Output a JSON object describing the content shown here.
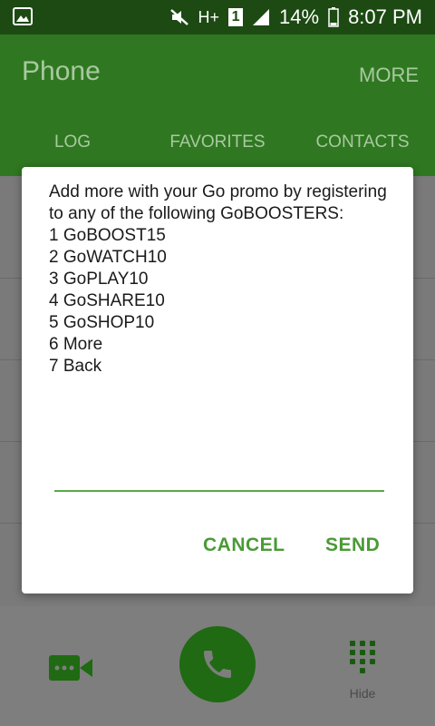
{
  "status_bar": {
    "battery": "14%",
    "time": "8:07 PM",
    "network": "H+",
    "sim": "1"
  },
  "app": {
    "title": "Phone",
    "more_label": "MORE"
  },
  "tabs": [
    {
      "label": "LOG"
    },
    {
      "label": "FAVORITES"
    },
    {
      "label": "CONTACTS"
    }
  ],
  "dialog": {
    "message": "Add more with your Go promo by registering to any of the following GoBOOSTERS:\n1 GoBOOST15\n2 GoWATCH10\n3 GoPLAY10\n4 GoSHARE10\n5 GoSHOP10\n6 More\n7 Back",
    "input_value": "",
    "cancel_label": "CANCEL",
    "send_label": "SEND"
  },
  "bottom_bar": {
    "keypad_label": "Hide"
  },
  "colors": {
    "accent": "#4a9a36",
    "appbar": "#2f7821",
    "statusbar": "#1c4a12",
    "call_button": "#1f6a12"
  },
  "icons": {
    "status_left": "gallery-icon",
    "mute": "mute-icon",
    "signal": "signal-icon",
    "battery": "battery-icon",
    "video": "video-call-icon",
    "call": "phone-icon",
    "keypad": "keypad-icon"
  }
}
